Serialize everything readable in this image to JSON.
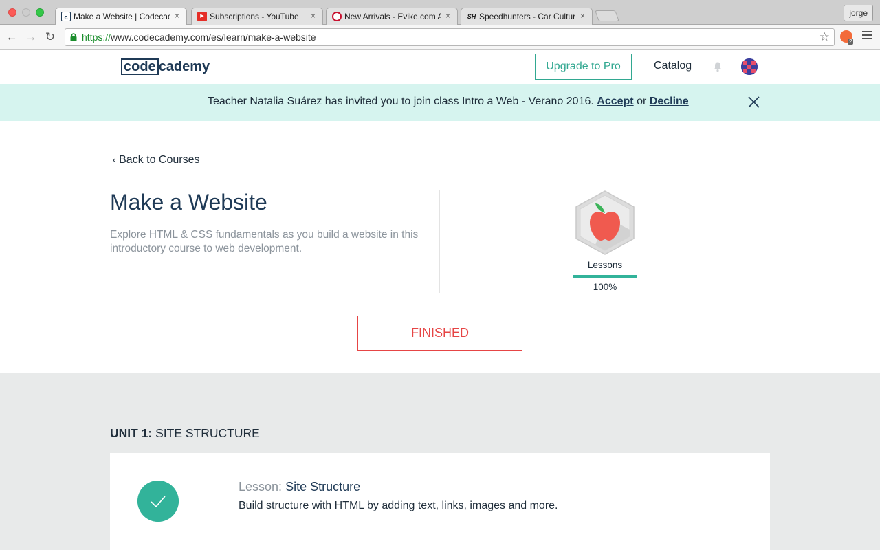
{
  "browser": {
    "tabs": [
      {
        "title": "Make a Website | Codecademy",
        "favicon": "codecademy-favicon",
        "active": true
      },
      {
        "title": "Subscriptions - YouTube",
        "favicon": "youtube-favicon",
        "active": false
      },
      {
        "title": "New Arrivals - Evike.com Airsoft",
        "favicon": "evike-favicon",
        "active": false
      },
      {
        "title": "Speedhunters - Car Culture",
        "favicon": "speedhunters-favicon",
        "active": false
      }
    ],
    "tab_close_glyph": "×",
    "profile_name": "jorge",
    "url_scheme": "https://",
    "url_rest": "www.codecademy.com/es/learn/make-a-website",
    "extension_badge": "2"
  },
  "header": {
    "logo_boxed": "code",
    "logo_rest": "cademy",
    "upgrade_label": "Upgrade to Pro",
    "catalog_label": "Catalog"
  },
  "banner": {
    "message": "Teacher Natalia Suárez has invited you to join class Intro a Web - Verano 2016.",
    "accept_label": "Accept",
    "or_text": "or",
    "decline_label": "Decline"
  },
  "course": {
    "back_label": "Back to Courses",
    "title": "Make a Website",
    "description": "Explore HTML & CSS fundamentals as you build a website in this introductory course to web development.",
    "lessons_label": "Lessons",
    "progress_fraction": 1.0,
    "progress_text": "100%",
    "status_button": "FINISHED"
  },
  "unit": {
    "number_label": "UNIT 1:",
    "name": "SITE STRUCTURE",
    "lesson": {
      "prefix": "Lesson:",
      "title": "Site Structure",
      "description": "Build structure with HTML by adding text, links, images and more.",
      "completed": true
    }
  },
  "colors": {
    "accent_teal": "#32b39a",
    "finished_red": "#e64545",
    "banner_bg": "#d6f4ef",
    "navy": "#1f3a56"
  }
}
